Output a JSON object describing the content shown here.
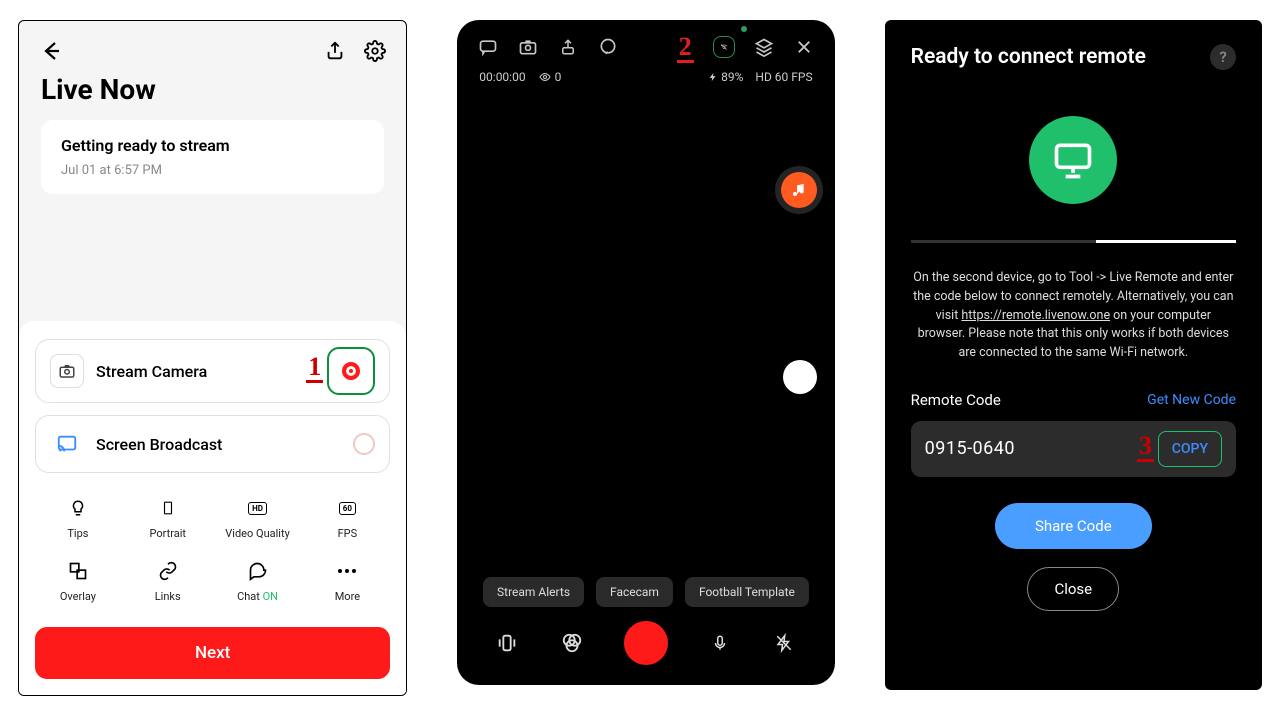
{
  "annotations": {
    "one": "1",
    "two": "2",
    "three": "3"
  },
  "screen1": {
    "title": "Live Now",
    "card": {
      "heading": "Getting ready to stream",
      "subtitle": "Jul 01 at 6:57 PM"
    },
    "rows": {
      "camera": "Stream Camera",
      "broadcast": "Screen Broadcast"
    },
    "grid": {
      "tips": "Tips",
      "portrait": "Portrait",
      "video_quality": "Video Quality",
      "fps": "FPS",
      "overlay": "Overlay",
      "links": "Links",
      "chat": "Chat",
      "chat_on": "ON",
      "more": "More",
      "hd_badge": "HD",
      "fps_badge": "60"
    },
    "next": "Next"
  },
  "screen2": {
    "status": {
      "time": "00:00:00",
      "viewers": "0",
      "battery": "89%",
      "quality": "HD 60 FPS"
    },
    "pills": {
      "alerts": "Stream Alerts",
      "facecam": "Facecam",
      "template": "Football Template"
    }
  },
  "screen3": {
    "title": "Ready to connect remote",
    "desc": {
      "l1": "On the second device, go to Tool -> Live Remote and enter the code below to connect remotely. Alternatively, you can visit ",
      "link1": "https://",
      "link2": "remote.livenow.one",
      "l2": " on your computer browser. Please note that this only works if both devices are connected to the same Wi-Fi network."
    },
    "remote_code_label": "Remote Code",
    "get_new_code": "Get New Code",
    "code": "0915-0640",
    "copy": "COPY",
    "share": "Share Code",
    "close": "Close"
  }
}
